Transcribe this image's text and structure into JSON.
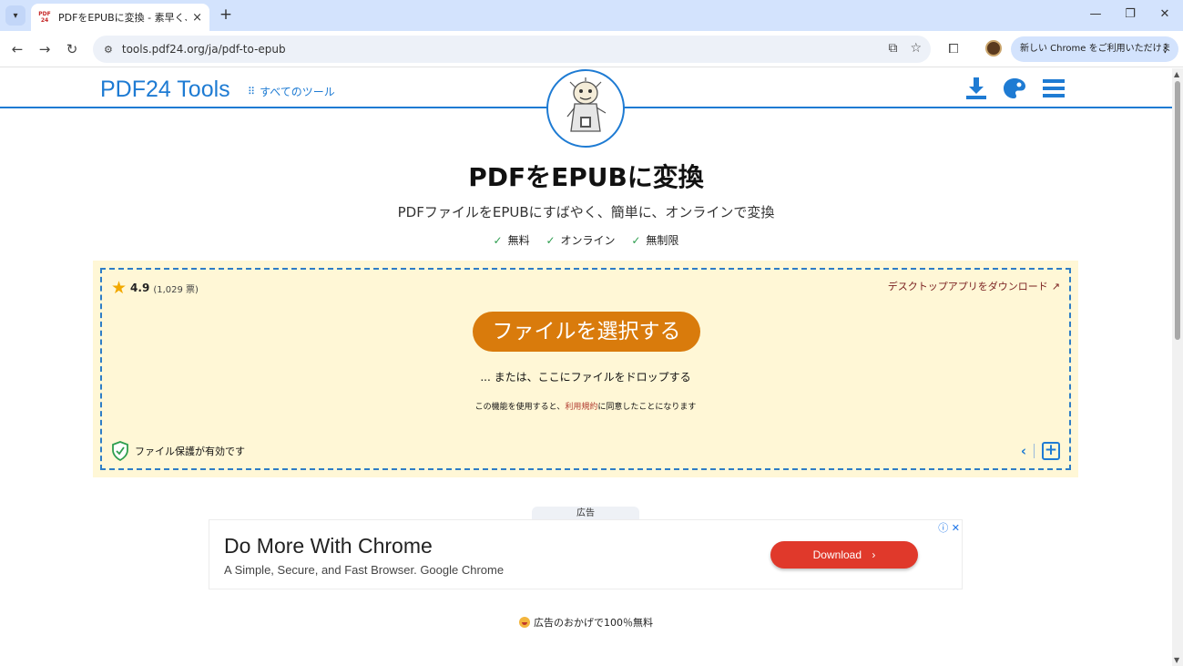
{
  "browser": {
    "tab": {
      "favicon_text": "PDF 24",
      "title": "PDFをEPUBに変換 - 素早く、オンラ",
      "close": "×"
    },
    "new_tab": "+",
    "window": {
      "minimize": "—",
      "restore": "❐",
      "close": "✕"
    },
    "nav": {
      "back": "←",
      "forward": "→",
      "reload": "↻"
    },
    "url": "tools.pdf24.org/ja/pdf-to-epub",
    "chrome_badge": "新しい Chrome をご利用いただけます",
    "menu_dots": "⋮"
  },
  "site": {
    "logo": "PDF24 Tools",
    "all_tools": "すべてのツール",
    "brand_color": "#1e7bd3"
  },
  "main": {
    "title": "PDFをEPUBに変換",
    "subtitle": "PDFファイルをEPUBにすばやく、簡単に、オンラインで変換",
    "features": [
      "無料",
      "オンライン",
      "無制限"
    ],
    "check": "✓"
  },
  "upload": {
    "rating": "4.9",
    "votes": "(1,029 票)",
    "desktop_link": "デスクトップアプリをダウンロード",
    "choose_button": "ファイルを選択する",
    "drop_text": "... または、ここにファイルをドロップする",
    "terms_prefix": "この機能を使用すると、",
    "terms_link": "利用規約",
    "terms_suffix": "に同意したことになります",
    "protection": "ファイル保護が有効です",
    "button_color": "#d97b0c",
    "background_color": "#fff7d6"
  },
  "ad": {
    "label": "広告",
    "headline": "Do More With Chrome",
    "description": "A Simple, Secure, and Fast Browser. Google Chrome",
    "button": "Download",
    "button_arrow": "›",
    "controls": "ⓘ ✕"
  },
  "footer": {
    "ad_free": "広告のおかげで100％無料"
  }
}
